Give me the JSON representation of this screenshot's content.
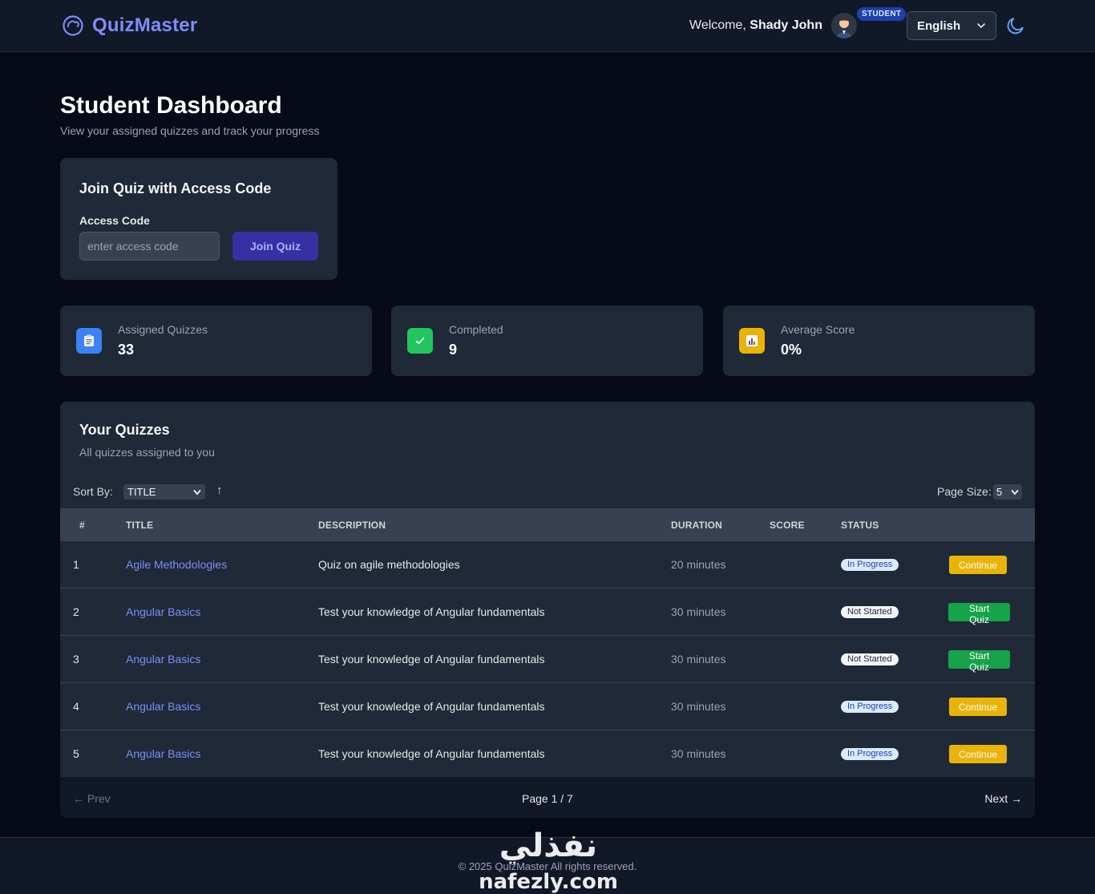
{
  "header": {
    "brand": "QuizMaster",
    "welcome_prefix": "Welcome, ",
    "user_name": "Shady John",
    "role_badge": "STUDENT",
    "language": "English",
    "icons": {
      "brand": "brain-logo-icon",
      "theme": "moon-icon",
      "dropdown": "chevron-down-icon"
    }
  },
  "page": {
    "title": "Student Dashboard",
    "subtitle": "View your assigned quizzes and track your progress"
  },
  "join": {
    "title": "Join Quiz with Access Code",
    "label": "Access Code",
    "placeholder": "enter access code",
    "button": "Join Quiz"
  },
  "stats": [
    {
      "label": "Assigned Quizzes",
      "value": "33",
      "icon": "clipboard-icon",
      "color": "#3b82f6"
    },
    {
      "label": "Completed",
      "value": "9",
      "icon": "check-icon",
      "color": "#22c55e"
    },
    {
      "label": "Average Score",
      "value": "0%",
      "icon": "bar-chart-icon",
      "color": "#eab308"
    }
  ],
  "quizzes": {
    "title": "Your Quizzes",
    "subtitle": "All quizzes assigned to you",
    "sort_label": "Sort By:",
    "sort_value": "TITLE",
    "sort_dir": "↑",
    "page_size_label": "Page Size:",
    "page_size": "5",
    "columns": [
      "#",
      "TITLE",
      "DESCRIPTION",
      "DURATION",
      "SCORE",
      "STATUS"
    ],
    "rows": [
      {
        "num": "1",
        "title": "Agile Methodologies",
        "description": "Quiz on agile methodologies",
        "duration": "20 minutes",
        "score": "",
        "status": "In Progress",
        "action": "Continue"
      },
      {
        "num": "2",
        "title": "Angular Basics",
        "description": "Test your knowledge of Angular fundamentals",
        "duration": "30 minutes",
        "score": "",
        "status": "Not Started",
        "action": "Start Quiz"
      },
      {
        "num": "3",
        "title": "Angular Basics",
        "description": "Test your knowledge of Angular fundamentals",
        "duration": "30 minutes",
        "score": "",
        "status": "Not Started",
        "action": "Start Quiz"
      },
      {
        "num": "4",
        "title": "Angular Basics",
        "description": "Test your knowledge of Angular fundamentals",
        "duration": "30 minutes",
        "score": "",
        "status": "In Progress",
        "action": "Continue"
      },
      {
        "num": "5",
        "title": "Angular Basics",
        "description": "Test your knowledge of Angular fundamentals",
        "duration": "30 minutes",
        "score": "",
        "status": "In Progress",
        "action": "Continue"
      }
    ],
    "pager": {
      "prev": "← Prev",
      "info": "Page 1 / 7",
      "next": "Next →"
    }
  },
  "footer": {
    "text": "© 2025 QuizMaster All rights reserved."
  },
  "watermark": {
    "arabic": "نفذلي",
    "latin": "nafezly.com"
  }
}
